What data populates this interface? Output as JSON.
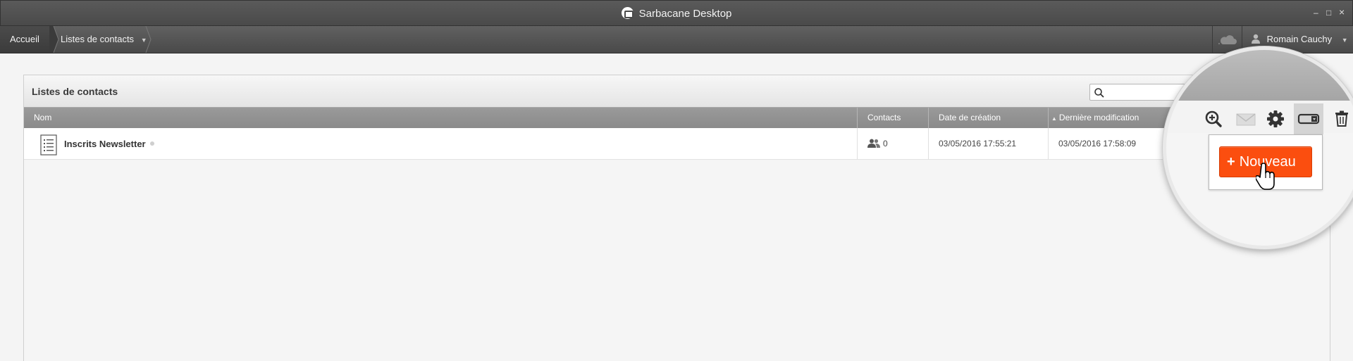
{
  "app": {
    "title": "Sarbacane Desktop"
  },
  "window_controls": {
    "minimize": "–",
    "maximize": "□",
    "close": "×"
  },
  "nav": {
    "home": "Accueil",
    "current": "Listes de contacts",
    "user": "Romain Cauchy"
  },
  "panel": {
    "title": "Listes de contacts",
    "search_placeholder": ""
  },
  "table": {
    "columns": {
      "name": "Nom",
      "contacts": "Contacts",
      "created": "Date de création",
      "modified": "Dernière modification"
    },
    "rows": [
      {
        "name": "Inscrits Newsletter",
        "contacts": "0",
        "created": "03/05/2016 17:55:21",
        "modified": "03/05/2016 17:58:09"
      }
    ]
  },
  "toolbar": {
    "icons": [
      "zoom-in-icon",
      "mail-icon",
      "gear-icon",
      "toggle-list-icon",
      "trash-icon"
    ],
    "new_button": "Nouveau"
  },
  "colors": {
    "accent": "#fb4e0f",
    "titlebar": "#4a4a4a",
    "header": "#8f8f8f"
  }
}
